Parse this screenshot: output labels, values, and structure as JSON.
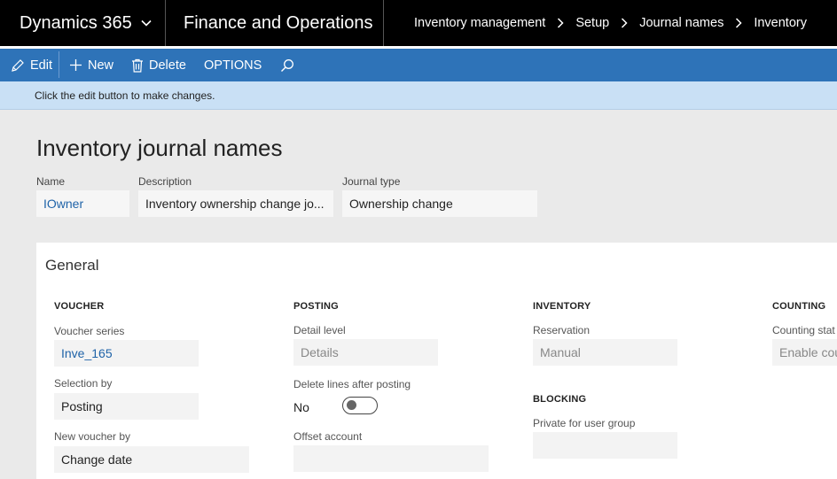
{
  "topbar": {
    "brand": "Dynamics 365",
    "module": "Finance and Operations",
    "breadcrumb": [
      "Inventory management",
      "Setup",
      "Journal names",
      "Inventory"
    ]
  },
  "actions": {
    "edit": "Edit",
    "new": "New",
    "delete": "Delete",
    "options": "OPTIONS"
  },
  "info_message": "Click the edit button to make changes.",
  "page": {
    "title": "Inventory journal names",
    "header_fields": {
      "name_label": "Name",
      "name_value": "IOwner",
      "description_label": "Description",
      "description_value": "Inventory ownership change jo...",
      "journal_type_label": "Journal type",
      "journal_type_value": "Ownership change"
    }
  },
  "general": {
    "title": "General",
    "voucher": {
      "heading": "VOUCHER",
      "voucher_series_label": "Voucher series",
      "voucher_series_value": "Inve_165",
      "selection_by_label": "Selection by",
      "selection_by_value": "Posting",
      "new_voucher_by_label": "New voucher by",
      "new_voucher_by_value": "Change date"
    },
    "posting": {
      "heading": "POSTING",
      "detail_level_label": "Detail level",
      "detail_level_value": "Details",
      "delete_lines_label": "Delete lines after posting",
      "delete_lines_value": "No",
      "offset_account_label": "Offset account",
      "offset_account_value": ""
    },
    "inventory": {
      "heading": "INVENTORY",
      "reservation_label": "Reservation",
      "reservation_value": "Manual"
    },
    "blocking": {
      "heading": "BLOCKING",
      "private_label": "Private for user group",
      "private_value": ""
    },
    "counting": {
      "heading": "COUNTING",
      "counting_status_label": "Counting stat",
      "counting_status_value": "Enable cou"
    }
  },
  "colors": {
    "topbar_bg": "#000000",
    "actionbar_bg": "#2e73b8",
    "infobar_bg": "#c9e0f5",
    "link": "#1f63a8"
  }
}
